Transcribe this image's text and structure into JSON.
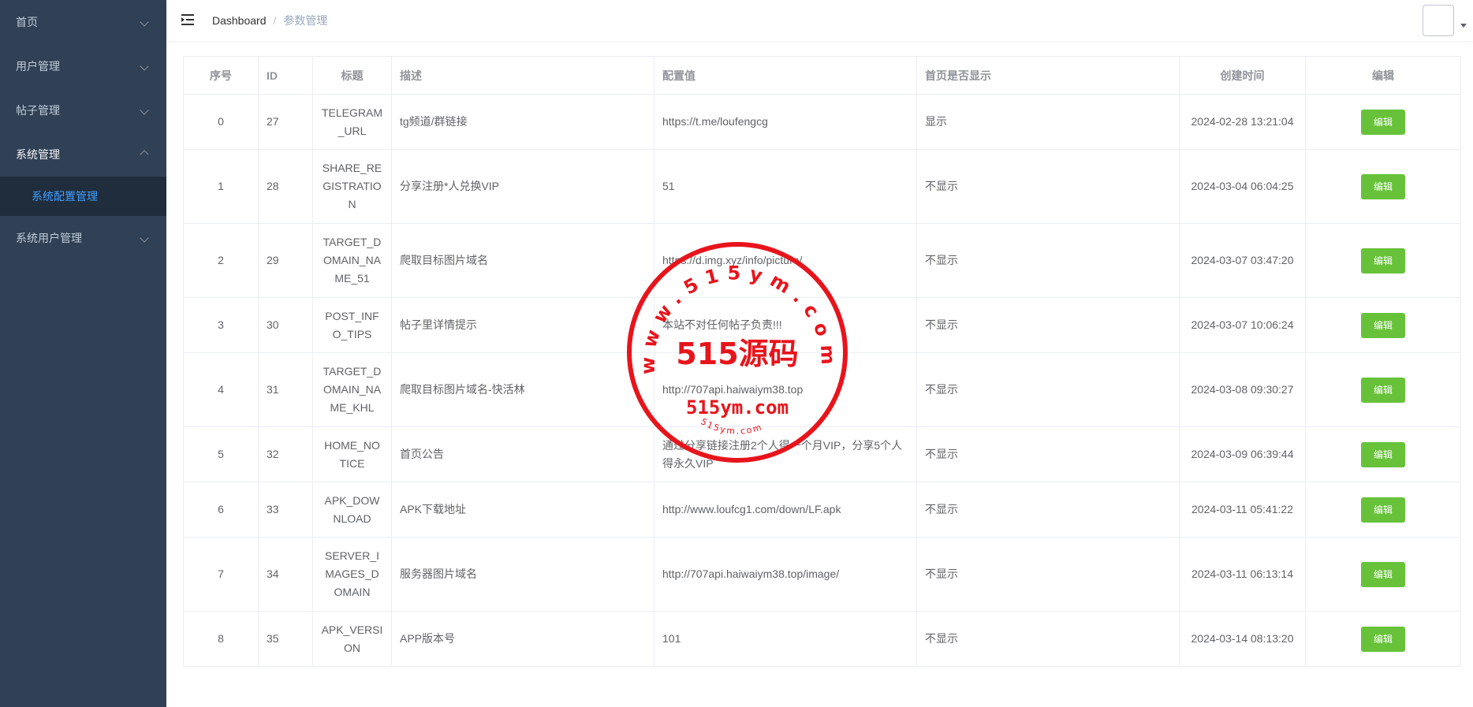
{
  "sidebar": {
    "items": [
      {
        "label": "首页"
      },
      {
        "label": "用户管理"
      },
      {
        "label": "帖子管理"
      },
      {
        "label": "系统管理"
      },
      {
        "label": "系统用户管理"
      }
    ],
    "subitem": {
      "label": "系统配置管理"
    }
  },
  "breadcrumb": {
    "home": "Dashboard",
    "separator": "/",
    "current": "参数管理"
  },
  "table": {
    "headers": [
      "序号",
      "ID",
      "标题",
      "描述",
      "配置值",
      "首页是否显示",
      "创建时间",
      "编辑"
    ],
    "edit_label": "编辑",
    "rows": [
      {
        "idx": "0",
        "id": "27",
        "title": "TELEGRAM_URL",
        "desc": "tg频道/群链接",
        "value": "https://t.me/loufengcg",
        "show": "显示",
        "time": "2024-02-28 13:21:04"
      },
      {
        "idx": "1",
        "id": "28",
        "title": "SHARE_REGISTRATION",
        "desc": "分享注册*人兑换VIP",
        "value": "51",
        "show": "不显示",
        "time": "2024-03-04 06:04:25"
      },
      {
        "idx": "2",
        "id": "29",
        "title": "TARGET_DOMAIN_NAME_51",
        "desc": "爬取目标图片域名",
        "value": "https://d.img.xyz/info/picture/",
        "show": "不显示",
        "time": "2024-03-07 03:47:20"
      },
      {
        "idx": "3",
        "id": "30",
        "title": "POST_INFO_TIPS",
        "desc": "帖子里详情提示",
        "value": "本站不对任何帖子负责!!!",
        "show": "不显示",
        "time": "2024-03-07 10:06:24"
      },
      {
        "idx": "4",
        "id": "31",
        "title": "TARGET_DOMAIN_NAME_KHL",
        "desc": "爬取目标图片域名-快活林",
        "value": "http://707api.haiwaiym38.top",
        "show": "不显示",
        "time": "2024-03-08 09:30:27"
      },
      {
        "idx": "5",
        "id": "32",
        "title": "HOME_NOTICE",
        "desc": "首页公告",
        "value": "通过分享链接注册2个人得一个月VIP，分享5个人得永久VIP",
        "show": "不显示",
        "time": "2024-03-09 06:39:44"
      },
      {
        "idx": "6",
        "id": "33",
        "title": "APK_DOWNLOAD",
        "desc": "APK下载地址",
        "value": "http://www.loufcg1.com/down/LF.apk",
        "show": "不显示",
        "time": "2024-03-11 05:41:22"
      },
      {
        "idx": "7",
        "id": "34",
        "title": "SERVER_IMAGES_DOMAIN",
        "desc": "服务器图片域名",
        "value": "http://707api.haiwaiym38.top/image/",
        "show": "不显示",
        "time": "2024-03-11 06:13:14"
      },
      {
        "idx": "8",
        "id": "35",
        "title": "APK_VERSION",
        "desc": "APP版本号",
        "value": "101",
        "show": "不显示",
        "time": "2024-03-14 08:13:20"
      }
    ]
  },
  "watermark": {
    "ring_text": "www.515ym.com",
    "main": "515源码",
    "sub": "515ym.com",
    "bottom": "515ym.com",
    "color": "#e8141c"
  },
  "colors": {
    "sidebar_bg": "#304156",
    "submenu_bg": "#1f2d3d",
    "active": "#409eff",
    "edit_btn": "#67c23a"
  }
}
